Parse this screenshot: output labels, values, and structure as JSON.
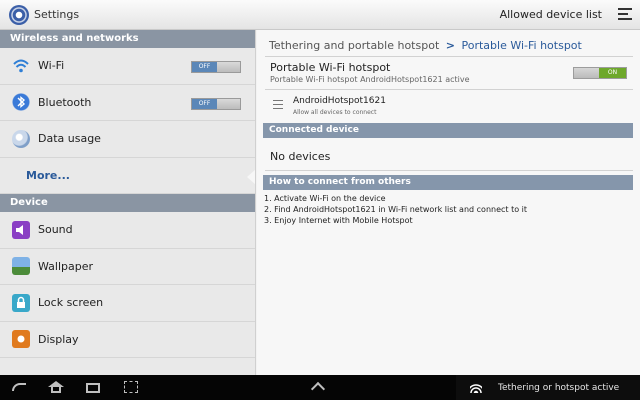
{
  "topbar": {
    "app_title": "Settings",
    "allowed_label": "Allowed device list",
    "app_icon": "settings-gear-icon",
    "menu_icon": "overflow-menu-icon"
  },
  "sidebar": {
    "sections": [
      {
        "title": "Wireless and networks"
      },
      {
        "title": "Device"
      }
    ],
    "items": [
      {
        "label": "Wi-Fi",
        "icon": "wifi-icon",
        "toggle": "OFF"
      },
      {
        "label": "Bluetooth",
        "icon": "bluetooth-icon",
        "toggle": "OFF"
      },
      {
        "label": "Data usage",
        "icon": "data-usage-icon"
      },
      {
        "label": "More...",
        "selected": true
      },
      {
        "label": "Sound",
        "icon": "sound-icon"
      },
      {
        "label": "Wallpaper",
        "icon": "wallpaper-icon"
      },
      {
        "label": "Lock screen",
        "icon": "lock-icon"
      },
      {
        "label": "Display",
        "icon": "display-icon"
      }
    ]
  },
  "content": {
    "breadcrumb_parent": "Tethering and portable hotspot",
    "breadcrumb_sep": ">",
    "breadcrumb_current": "Portable Wi-Fi hotspot",
    "hotspot_title": "Portable Wi-Fi hotspot",
    "hotspot_subtitle": "Portable Wi-Fi hotspot AndroidHotspot1621 active",
    "hotspot_toggle": "ON",
    "ap_name": "AndroidHotspot1621",
    "ap_subtitle": "Allow all devices to connect",
    "connected_header": "Connected device",
    "no_devices": "No devices",
    "howto_header": "How to connect from others",
    "steps": [
      "1. Activate Wi-Fi on the device",
      "2. Find AndroidHotspot1621 in Wi-Fi network list and connect to it",
      "3. Enjoy Internet with Mobile Hotspot"
    ]
  },
  "sysbar": {
    "notification": "Tethering or hotspot active"
  },
  "colors": {
    "accent": "#2a5a9a",
    "section_header": "#8a95a3",
    "toggle_on": "#6ea82b",
    "toggle_off": "#5b87b8"
  }
}
